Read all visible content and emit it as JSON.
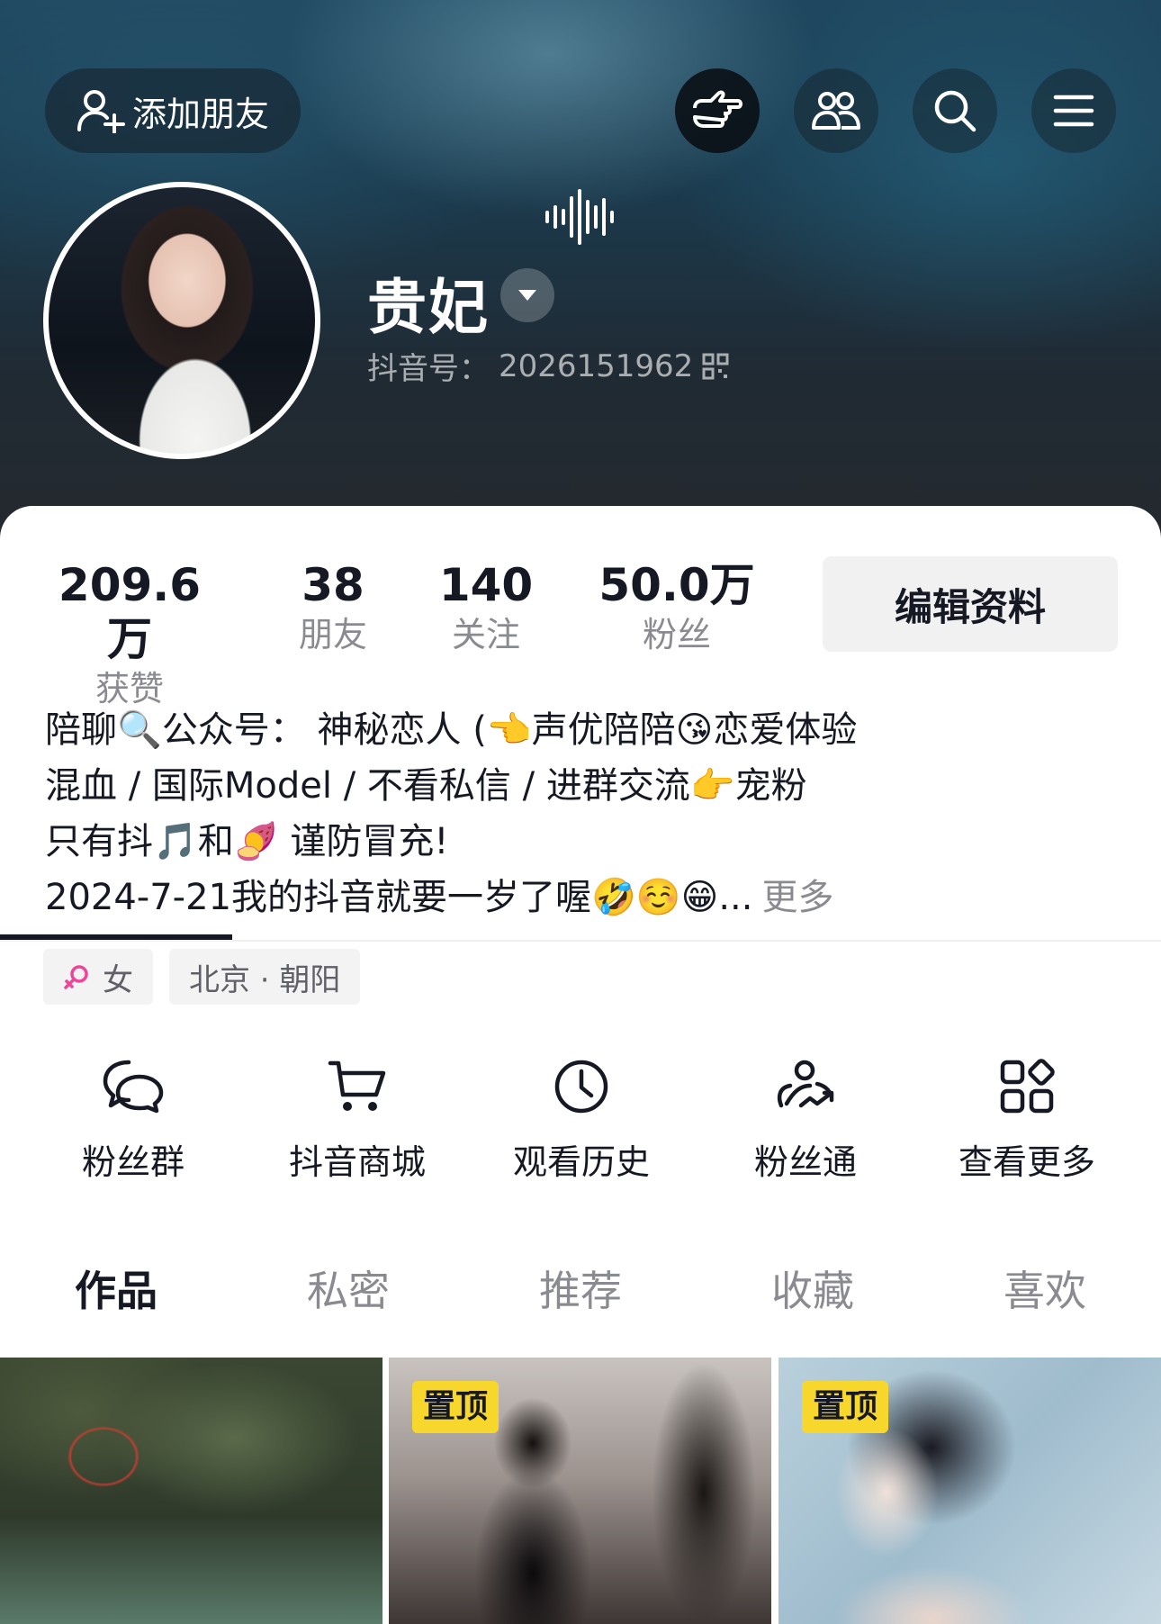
{
  "header": {
    "add_friend_label": "添加朋友",
    "username": "贵妃",
    "douyin_id_label": "抖音号：",
    "douyin_id": "2026151962"
  },
  "stats": [
    {
      "value": "209.6万",
      "label": "获赞"
    },
    {
      "value": "38",
      "label": "朋友"
    },
    {
      "value": "140",
      "label": "关注"
    },
    {
      "value": "50.0万",
      "label": "粉丝"
    }
  ],
  "edit_profile_label": "编辑资料",
  "bio": {
    "line1_a": "陪聊",
    "line1_b": "公众号：  神秘恋人 (",
    "line1_c": "声优陪陪",
    "line1_d": "恋爱体验",
    "line2_a": "混血 / 国际Model / 不看私信 / 进群交流",
    "line2_b": "宠粉",
    "line3_a": "只有抖",
    "line3_b": "和",
    "line3_c": " 谨防冒充!",
    "line4_a": "2024-7-21我的抖音就要一岁了喔",
    "line4_ellipsis": "...",
    "more_label": "更多"
  },
  "tags": {
    "gender": "女",
    "location": "北京 · 朝阳"
  },
  "services": [
    {
      "label": "粉丝群",
      "icon": "chat-bubbles-icon"
    },
    {
      "label": "抖音商城",
      "icon": "cart-icon"
    },
    {
      "label": "观看历史",
      "icon": "clock-icon"
    },
    {
      "label": "粉丝通",
      "icon": "users-trend-icon"
    },
    {
      "label": "查看更多",
      "icon": "grid-icon"
    }
  ],
  "tabs": [
    "作品",
    "私密",
    "推荐",
    "收藏",
    "喜欢"
  ],
  "active_tab": "作品",
  "videos": [
    {
      "pinned": false
    },
    {
      "pinned": true,
      "pin_label": "置顶"
    },
    {
      "pinned": true,
      "pin_label": "置顶"
    }
  ],
  "colors": {
    "accent_pin": "#f8d72d",
    "text_primary": "#161823",
    "text_secondary": "#8a8b91",
    "female_icon": "#f0449a"
  }
}
